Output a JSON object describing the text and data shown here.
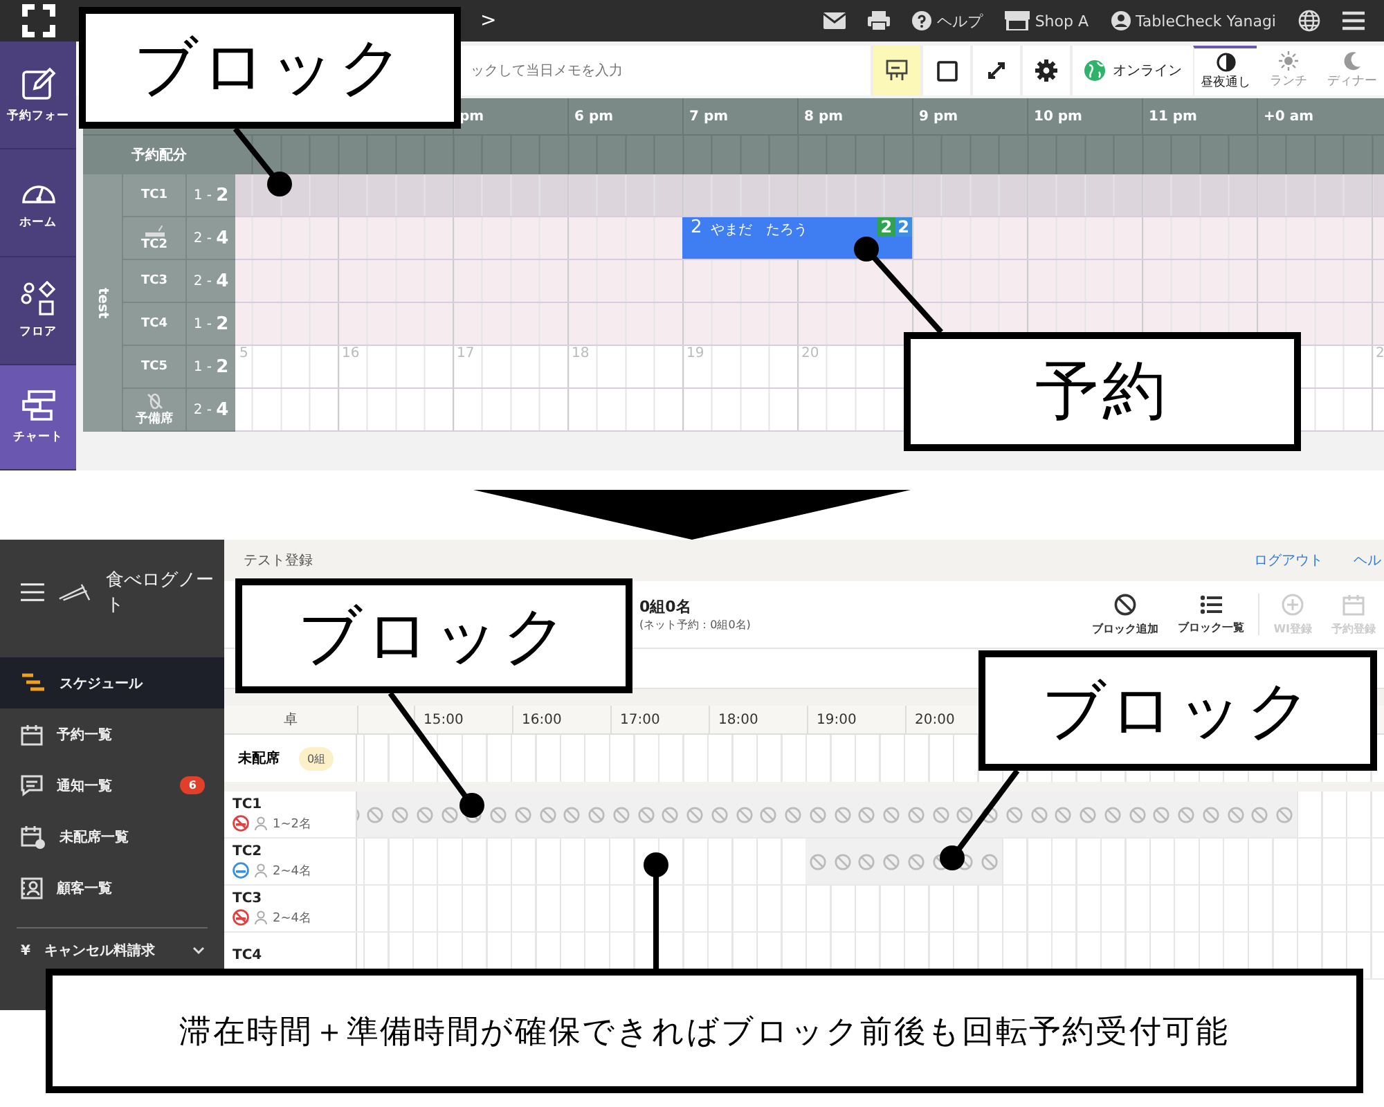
{
  "top_screen": {
    "header": {
      "items": [
        {
          "kind": "mail"
        },
        {
          "kind": "print"
        },
        {
          "kind": "help",
          "label": "ヘルプ"
        },
        {
          "kind": "shop",
          "label": "Shop A"
        },
        {
          "kind": "user",
          "label": "TableCheck Yanagi"
        },
        {
          "kind": "globe"
        },
        {
          "kind": "menu"
        }
      ]
    },
    "nav_arrow": ">",
    "sidebar": [
      {
        "kind": "pencil",
        "label": "予約フォー",
        "selected": false
      },
      {
        "kind": "gauge",
        "label": "ホーム",
        "selected": false
      },
      {
        "kind": "shapes",
        "label": "フロア",
        "selected": false
      },
      {
        "kind": "chart",
        "label": "チャート",
        "selected": true
      }
    ],
    "memo": {
      "placeholder": "ックして当日メモを入力"
    },
    "tools": [
      {
        "kind": "present",
        "selected": true
      },
      {
        "kind": "square",
        "selected": false
      },
      {
        "kind": "expand",
        "selected": false
      },
      {
        "kind": "gear",
        "selected": false
      }
    ],
    "online": {
      "label": "オンライン"
    },
    "services": [
      {
        "kind": "daynight",
        "label": "昼夜通し",
        "selected": true
      },
      {
        "kind": "sun",
        "label": "ランチ",
        "selected": false
      },
      {
        "kind": "moon",
        "label": "ディナー",
        "selected": false
      }
    ],
    "hours": [
      "pm",
      "6 pm",
      "7 pm",
      "8 pm",
      "9 pm",
      "10 pm",
      "11 pm",
      "+0 am"
    ],
    "allocation_label": "予約配分",
    "area": "test",
    "tables": [
      {
        "kind": "plain",
        "name": "TC1",
        "capacity": "1 - **2**",
        "blocked": true
      },
      {
        "kind": "smoking",
        "name": "TC2",
        "capacity": "2 - **4**",
        "blocked": false,
        "highlighted": true,
        "reservations": [
          {
            "covers": "2",
            "name": "やまだ　たろう",
            "badges": [
              {
                "text": "2",
                "color": "#2ea44f"
              },
              {
                "text": "2",
                "color": "#3b8fe0"
              }
            ]
          }
        ]
      },
      {
        "kind": "plain",
        "name": "TC3",
        "capacity": "2 - **4**",
        "blocked": false,
        "highlighted": true
      },
      {
        "kind": "plain",
        "name": "TC4",
        "capacity": "1 - **2**",
        "blocked": false,
        "highlighted": true
      },
      {
        "kind": "plain",
        "name": "TC5",
        "capacity": "1 - **2**",
        "blocked": false,
        "highlighted": false,
        "marks": [
          "5",
          "16",
          "17",
          "18",
          "19",
          "20",
          "2"
        ]
      },
      {
        "kind": "spare",
        "name": "予備席",
        "capacity": "2 - **4**",
        "blocked": false,
        "highlighted": false
      }
    ]
  },
  "bottom_screen": {
    "logo": "食べログノート",
    "nav": [
      {
        "kind": "schedule",
        "label": "スケジュール",
        "selected": true
      },
      {
        "kind": "calendar",
        "label": "予約一覧",
        "selected": false
      },
      {
        "kind": "message",
        "label": "通知一覧",
        "selected": false,
        "badge": "6"
      },
      {
        "kind": "calendar-info",
        "label": "未配席一覧",
        "selected": false
      },
      {
        "kind": "contact",
        "label": "顧客一覧",
        "selected": false
      }
    ],
    "extra": {
      "symbol": "¥",
      "label": "キャンセル料請求"
    },
    "breadcrumb": "テスト登録",
    "links": [
      "ログアウト",
      "ヘル"
    ],
    "summary": {
      "count": "0組0名",
      "net": "(ネット予約：0組0名)"
    },
    "actions": [
      {
        "kind": "block",
        "label": "ブロック追加",
        "disabled": false
      },
      {
        "kind": "list",
        "label": "ブロック一覧",
        "disabled": false
      },
      {
        "kind": "plus",
        "label": "WI登録",
        "disabled": true
      },
      {
        "kind": "calendar",
        "label": "予約登録",
        "disabled": true
      }
    ],
    "table_header": "卓",
    "hours": [
      "15:00",
      "16:00",
      "17:00",
      "18:00",
      "19:00",
      "20:00"
    ],
    "unassigned": {
      "label": "未配席",
      "count": "0組"
    },
    "tables": [
      {
        "name": "TC1",
        "smoking": false,
        "capacity": "1~2名",
        "blocked": true
      },
      {
        "name": "TC2",
        "smoking": true,
        "capacity": "2~4名",
        "blocked": true
      },
      {
        "name": "TC3",
        "smoking": false,
        "capacity": "2~4名"
      },
      {
        "name": "TC4"
      }
    ]
  },
  "annotations": [
    {
      "text": "ブロック"
    },
    {
      "text": "予約"
    },
    {
      "text": "ブロック"
    },
    {
      "text": "ブロック"
    },
    {
      "text": "滞在時間＋準備時間が確保できればブロック前後も回転予約受付可能"
    }
  ]
}
